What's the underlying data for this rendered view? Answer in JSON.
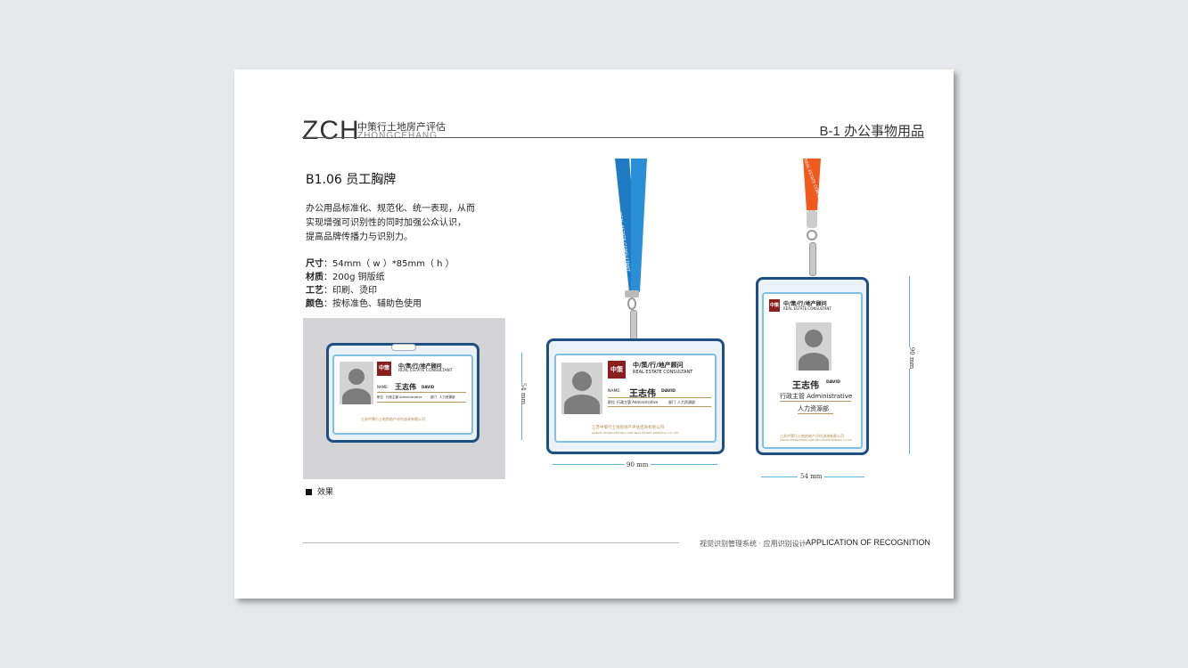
{
  "header": {
    "brand": "ZCH",
    "brand_cn": "中策行土地房产评估",
    "brand_en": "ZHONGCEHANG",
    "section": "B-1  办公事物用品"
  },
  "content": {
    "title": "B1.06 员工胸牌",
    "description_lines": [
      "办公用品标准化、规范化、统一表现，从而",
      "实现增强可识别性的同时加强公众认识，",
      "提高品牌传播力与识别力。"
    ],
    "specs": [
      {
        "label": "尺寸",
        "value": "54mm（ w ）*85mm（ h ）"
      },
      {
        "label": "材质",
        "value": "200g 铜版纸"
      },
      {
        "label": "工艺",
        "value": "印刷、烫印"
      },
      {
        "label": "颜色",
        "value": "按标准色、辅助色使用"
      }
    ],
    "effect_label": "效果"
  },
  "badge": {
    "company_name": "中/策/行/地产顾问",
    "company_en": "REAL ESTATE CONSULTANT",
    "seal_text": "中策行",
    "name_prefix": "NAME:",
    "name": "王志伟",
    "name_en": "DAVID",
    "position_label": "职位",
    "position": "行政主管 Administrative",
    "dept_label": "部门",
    "dept": "人力资源部",
    "footer_company": "江苏中策行土地房地产评估咨询有限公司",
    "footer_company_en": "JIANGSU ZHONGCEHANG LAND REAL ESTATE APPRAISAL CO.,LTD",
    "vertical_title": "行政主管 Administrative",
    "vertical_dept": "人力资源部",
    "lanyard_text": "REAL ESTATE CONSULTANT"
  },
  "dimensions": {
    "h_width": "90 mm",
    "h_height": "54 mm",
    "v_width": "54 mm",
    "v_height": "90 mm"
  },
  "footer": {
    "cn": "视觉识别管理系统 · 应用识别设计",
    "en": "APPLICATION OF RECOGNITION"
  },
  "colors": {
    "lanyard_blue": "#2a8fd6",
    "lanyard_orange": "#ef5a1e",
    "frame_navy": "#1d4f85",
    "seal_red": "#8b1e1e"
  }
}
